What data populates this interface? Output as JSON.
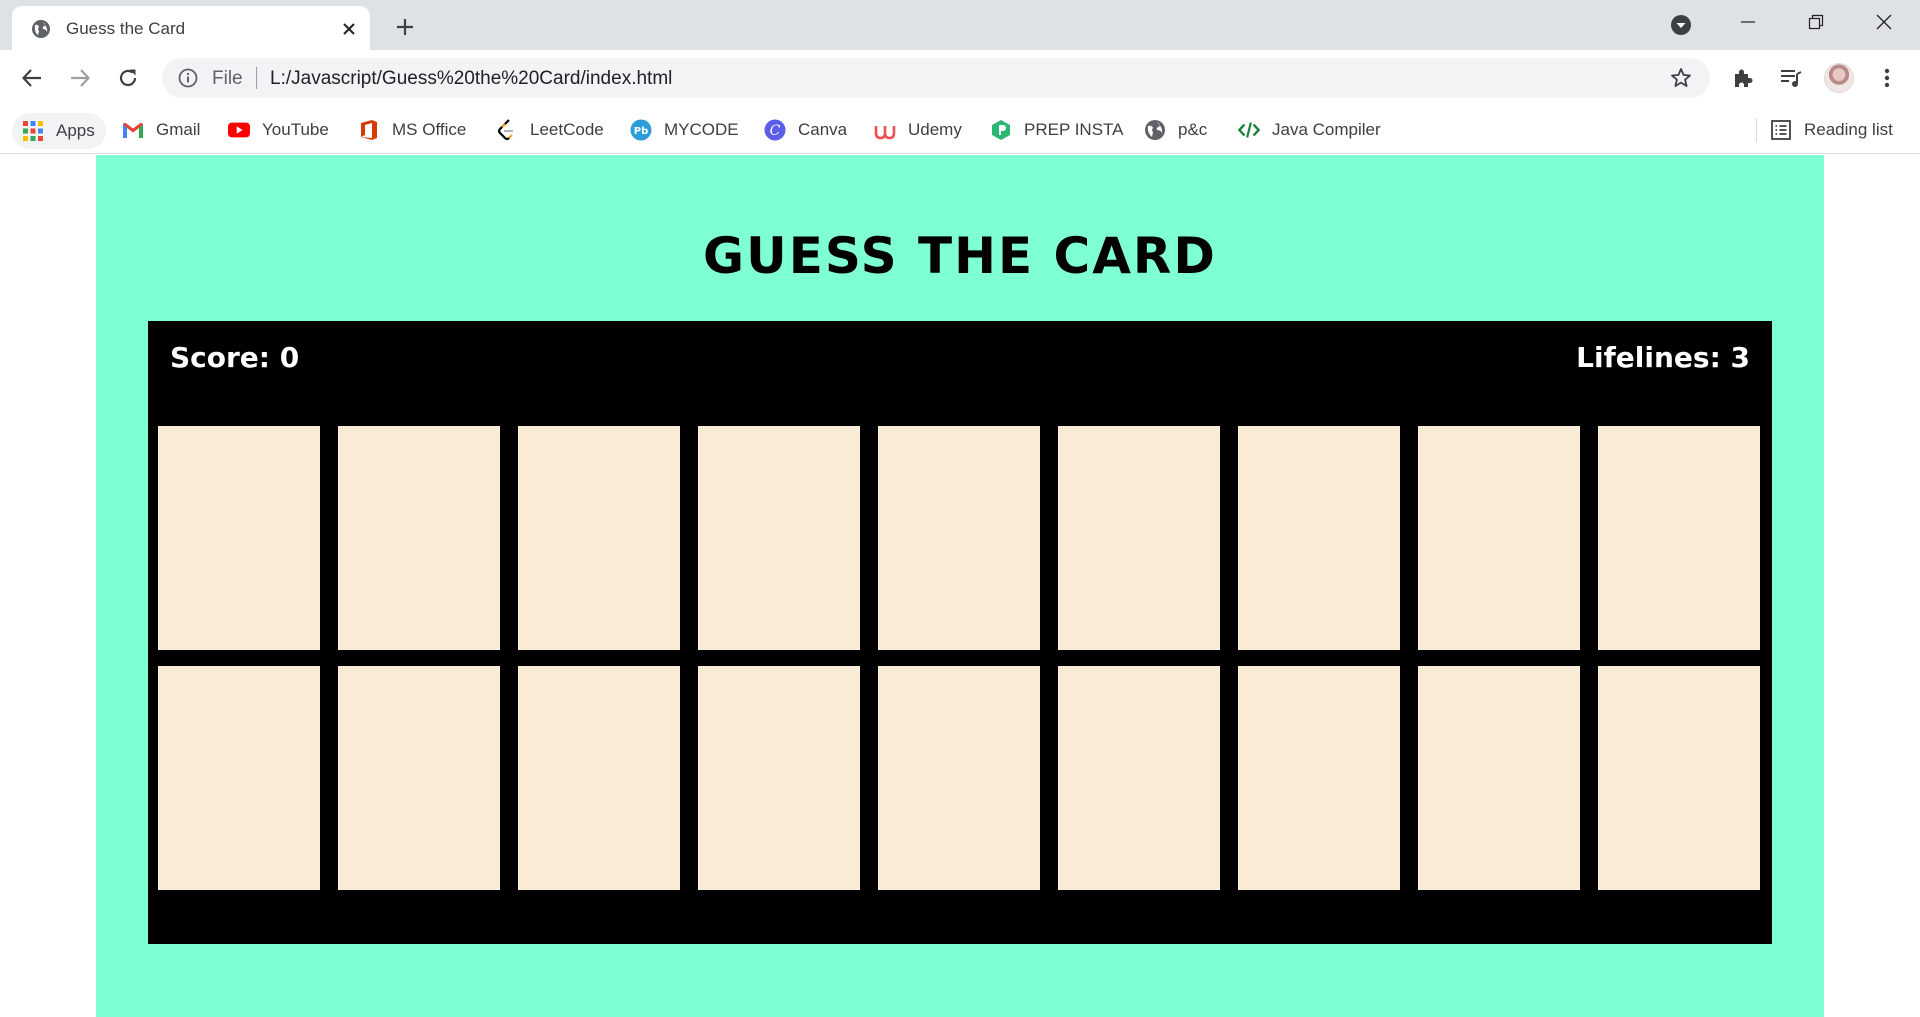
{
  "browser": {
    "tab": {
      "title": "Guess the Card"
    },
    "address_bar": {
      "scheme_label": "File",
      "url": "L:/Javascript/Guess%20the%20Card/index.html"
    },
    "bookmarks": {
      "apps_label": "Apps",
      "items": [
        {
          "label": "Gmail",
          "icon": "gmail-icon"
        },
        {
          "label": "YouTube",
          "icon": "youtube-icon"
        },
        {
          "label": "MS Office",
          "icon": "ms-office-icon"
        },
        {
          "label": "LeetCode",
          "icon": "leetcode-icon"
        },
        {
          "label": "MYCODE",
          "icon": "mycode-icon"
        },
        {
          "label": "Canva",
          "icon": "canva-icon"
        },
        {
          "label": "Udemy",
          "icon": "udemy-icon"
        },
        {
          "label": "PREP INSTA",
          "icon": "prep-insta-icon"
        },
        {
          "label": "p&c",
          "icon": "globe-icon"
        },
        {
          "label": "Java Compiler",
          "icon": "code-icon"
        }
      ],
      "reading_list_label": "Reading list"
    }
  },
  "game": {
    "title": "GUESS THE CARD",
    "score_text": "Score: 0",
    "lifelines_text": "Lifelines: 3",
    "card_count": 18,
    "colors": {
      "background": "#7fffd4",
      "board": "#000000",
      "card_back": "#faebd7"
    }
  }
}
